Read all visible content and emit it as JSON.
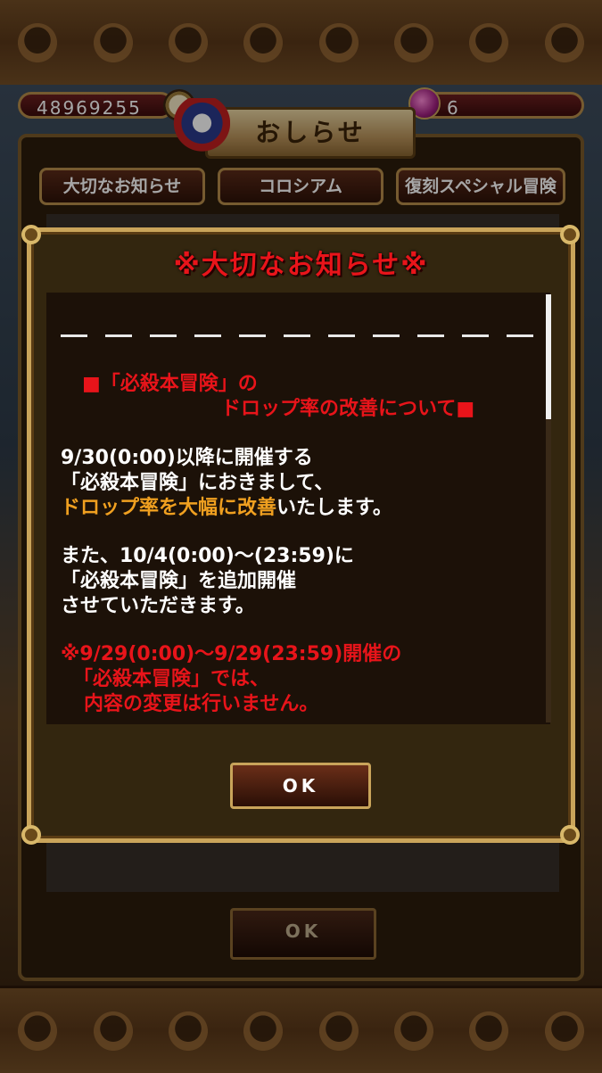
{
  "header": {
    "beli": "48969255",
    "gems": "6",
    "panel_title": "おしらせ"
  },
  "tabs": [
    {
      "label": "大切なお知らせ"
    },
    {
      "label": "コロシアム"
    },
    {
      "label": "復刻スペシャル冒険"
    }
  ],
  "background_ok_label": "OK",
  "modal": {
    "title": "※大切なお知らせ※",
    "heading_line1": "■「必殺本冒険」の",
    "heading_line2": "ドロップ率の改善について■",
    "para1_line1": "9/30(0:00)以降に開催する",
    "para1_line2": "「必殺本冒険」におきまして、",
    "para1_line3_highlight": "ドロップ率を大幅に改善",
    "para1_line3_rest": "いたします。",
    "para2_line1": "また、10/4(0:00)～(23:59)に",
    "para2_line2": "「必殺本冒険」を追加開催",
    "para2_line3": "させていただきます。",
    "note_line1": "※9/29(0:00)～9/29(23:59)開催の",
    "note_line2": "「必殺本冒険」では、",
    "note_line3": "内容の変更は行いません。",
    "ok_label": "OK"
  },
  "colors": {
    "accent_red": "#e8141a",
    "highlight_orange": "#f0a020",
    "frame_gold": "#c9a45a"
  }
}
